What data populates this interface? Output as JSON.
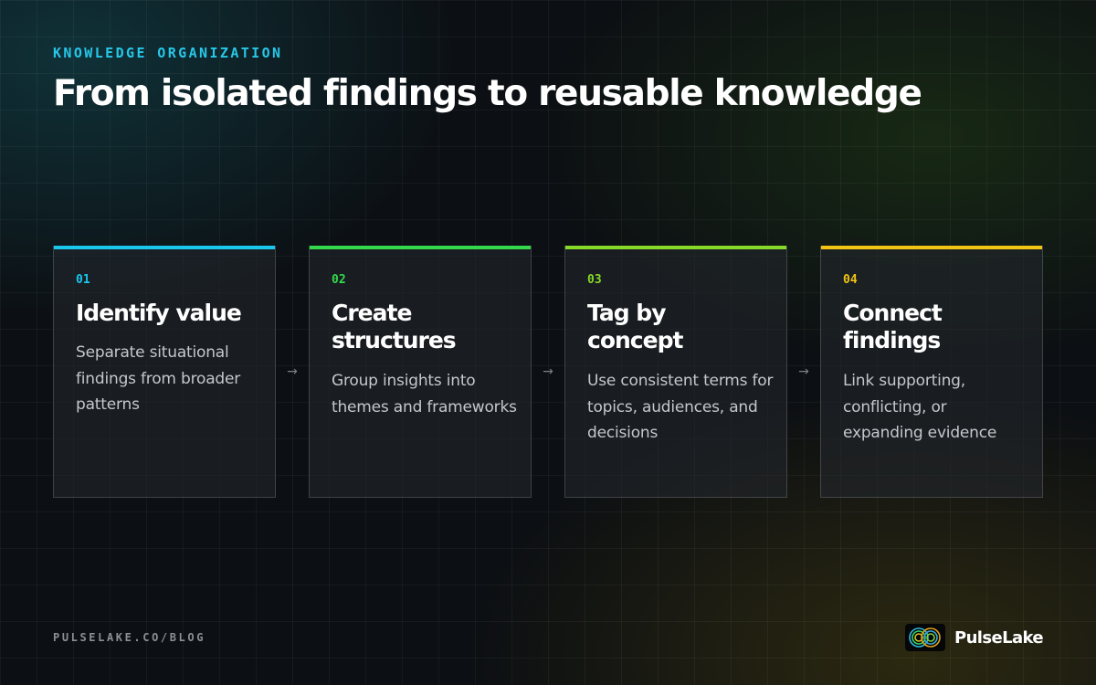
{
  "header": {
    "eyebrow": "KNOWLEDGE ORGANIZATION",
    "title": "From isolated findings to reusable knowledge"
  },
  "steps": [
    {
      "number": "01",
      "title": "Identify value",
      "description": "Separate situational findings from broader patterns",
      "accent": "#19c6ec"
    },
    {
      "number": "02",
      "title": "Create structures",
      "description": "Group insights into themes and frameworks",
      "accent": "#33d94a"
    },
    {
      "number": "03",
      "title": "Tag by concept",
      "description": "Use consistent terms for topics, audiences, and decisions",
      "accent": "#86d928"
    },
    {
      "number": "04",
      "title": "Connect findings",
      "description": "Link supporting, conflicting, or expanding evidence",
      "accent": "#f2c414"
    }
  ],
  "arrows": [
    "→",
    "→",
    "→"
  ],
  "footer": {
    "url": "PULSELAKE.CO/BLOG",
    "brand_name": "PulseLake",
    "logo_icon": "pulselake-logo-icon"
  }
}
